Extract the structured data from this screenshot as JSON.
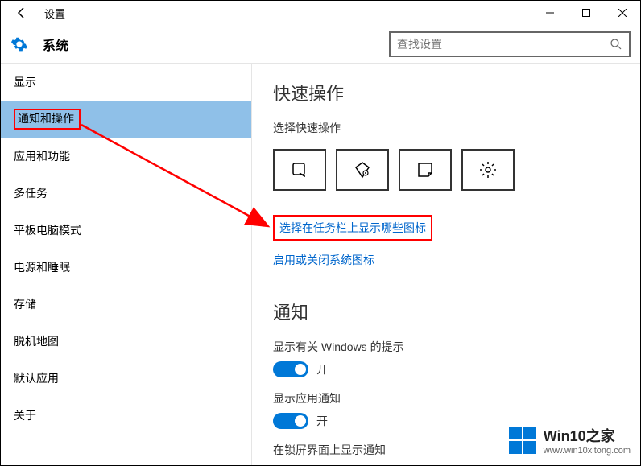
{
  "titlebar": {
    "title": "设置"
  },
  "header": {
    "title": "系统",
    "search_placeholder": "查找设置"
  },
  "sidebar": {
    "items": [
      {
        "label": "显示"
      },
      {
        "label": "通知和操作"
      },
      {
        "label": "应用和功能"
      },
      {
        "label": "多任务"
      },
      {
        "label": "平板电脑模式"
      },
      {
        "label": "电源和睡眠"
      },
      {
        "label": "存储"
      },
      {
        "label": "脱机地图"
      },
      {
        "label": "默认应用"
      },
      {
        "label": "关于"
      }
    ]
  },
  "main": {
    "quick_actions": {
      "title": "快速操作",
      "subtitle": "选择快速操作",
      "items": [
        {
          "icon": "tablet"
        },
        {
          "icon": "note"
        },
        {
          "icon": "sticky"
        },
        {
          "icon": "gear"
        }
      ]
    },
    "links": {
      "taskbar_icons": "选择在任务栏上显示哪些图标",
      "system_icons": "启用或关闭系统图标"
    },
    "notifications": {
      "title": "通知",
      "toggles": [
        {
          "label": "显示有关 Windows 的提示",
          "state": "开"
        },
        {
          "label": "显示应用通知",
          "state": "开"
        },
        {
          "label": "在锁屏界面上显示通知",
          "state": ""
        }
      ]
    }
  },
  "watermark": {
    "main": "Win10之家",
    "sub": "www.win10xitong.com"
  }
}
